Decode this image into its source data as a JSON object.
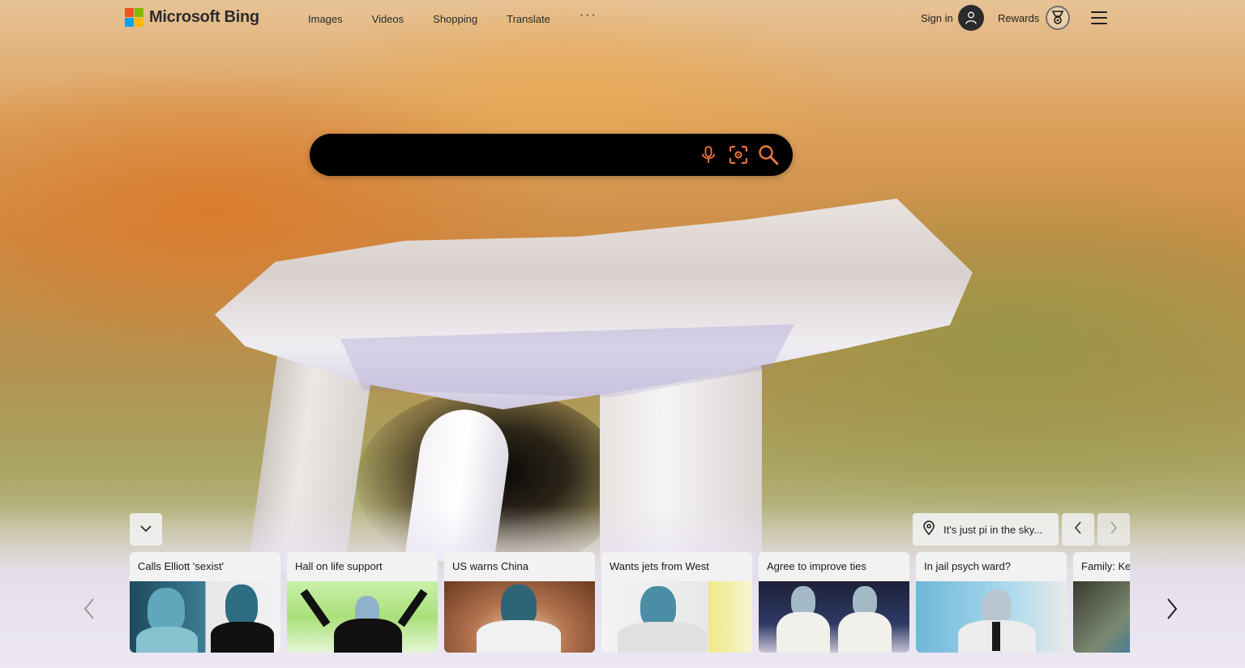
{
  "brand": {
    "name": "Microsoft Bing",
    "logo_colors": [
      "#f25022",
      "#7fba00",
      "#00a4ef",
      "#ffb900"
    ]
  },
  "nav": {
    "items": [
      {
        "label": "Images"
      },
      {
        "label": "Videos"
      },
      {
        "label": "Shopping"
      },
      {
        "label": "Translate"
      }
    ],
    "more_label": "···"
  },
  "header": {
    "sign_in_label": "Sign in",
    "rewards_label": "Rewards",
    "avatar_icon": "user-icon",
    "rewards_icon": "medal-icon",
    "menu_icon": "hamburger-icon"
  },
  "search": {
    "value": "",
    "placeholder": "",
    "icons": [
      "microphone-icon",
      "visual-search-icon",
      "search-icon"
    ],
    "accent_color": "#f07a3c"
  },
  "background_info": {
    "location_text": "It's just pi in the sky...",
    "location_icon": "map-pin-icon"
  },
  "news": {
    "cards": [
      {
        "title": "Calls Elliott 'sexist'"
      },
      {
        "title": "Hall on life support"
      },
      {
        "title": "US warns China"
      },
      {
        "title": "Wants jets from West"
      },
      {
        "title": "Agree to improve ties"
      },
      {
        "title": "In jail psych ward?"
      },
      {
        "title": "Family: Ke"
      }
    ]
  }
}
